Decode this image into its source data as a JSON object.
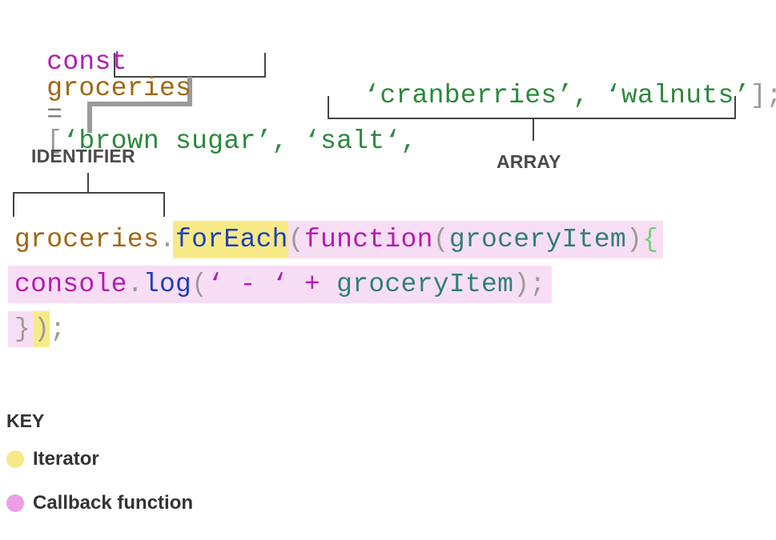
{
  "code_line_1": {
    "kw": "const",
    "identifier": "groceries",
    "op": "=",
    "open_bracket": "[",
    "items_line1": "‘brown sugar’, ‘salt‘,",
    "items_line2": "‘cranberries’, ‘walnuts’",
    "close": "];"
  },
  "labels": {
    "identifier": "IDENTIFIER",
    "array": "ARRAY"
  },
  "code_line_3": {
    "identifier": "groceries",
    "dot": ".",
    "method": "forEach",
    "paren": "(",
    "function_kw": "function",
    "paren2": "(",
    "param": "groceryItem",
    "paren3": ")",
    "brace": "{"
  },
  "code_line_4": {
    "console": "console",
    "dot": ".",
    "log": "log",
    "paren": "(",
    "string": "‘ - ‘",
    "plus": "+",
    "param": "groceryItem",
    "close": ");"
  },
  "code_line_5": {
    "brace": "}",
    "paren": ")",
    "semi": ";"
  },
  "key": {
    "title": "KEY",
    "items": [
      {
        "label": "Iterator",
        "color": "#f7ea86"
      },
      {
        "label": "Callback function",
        "color": "#ee9ee6"
      }
    ]
  }
}
